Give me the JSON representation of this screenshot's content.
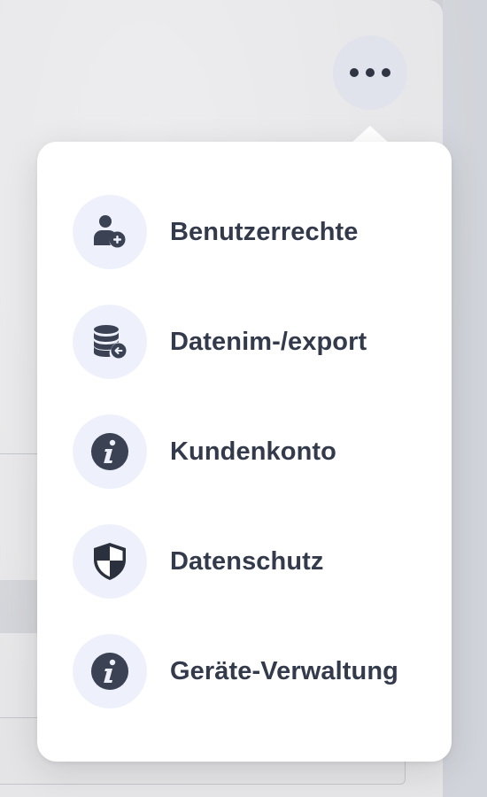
{
  "more_button": {
    "icon": "ellipsis-icon"
  },
  "menu": {
    "items": [
      {
        "label": "Benutzerrechte",
        "icon": "user-plus-icon"
      },
      {
        "label": "Datenim-/export",
        "icon": "database-import-icon"
      },
      {
        "label": "Kundenkonto",
        "icon": "info-icon"
      },
      {
        "label": "Datenschutz",
        "icon": "shield-icon"
      },
      {
        "label": "Geräte-Verwaltung",
        "icon": "info-icon"
      }
    ]
  },
  "colors": {
    "icon_bg": "#eef1fb",
    "icon_fg": "#3b4254",
    "label": "#333a4b",
    "popover_bg": "#ffffff",
    "more_button_bg": "#e1e3ec"
  }
}
